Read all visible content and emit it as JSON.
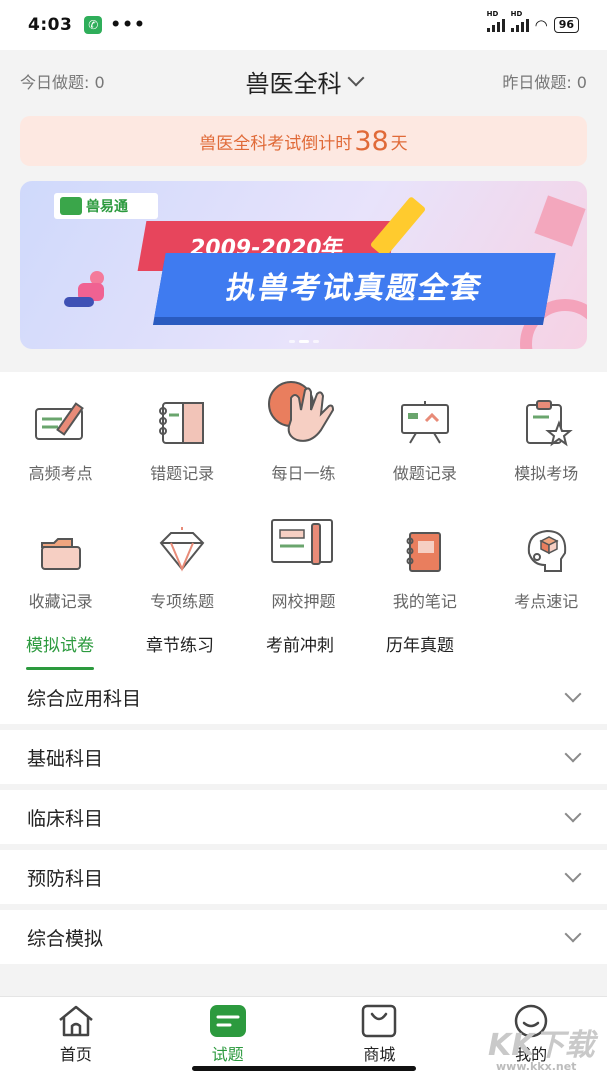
{
  "status_bar": {
    "time": "4:03",
    "more": "•••",
    "signal_tag": "HD",
    "battery": "96"
  },
  "header": {
    "today_count": "今日做题: 0",
    "title": "兽医全科",
    "yesterday_count": "昨日做题: 0"
  },
  "countdown": {
    "prefix": "兽医全科考试倒计时",
    "days": "38",
    "suffix": "天"
  },
  "banner": {
    "logo_text": "兽易通",
    "year_range": "2009-2020年",
    "headline": "执兽考试真题全套"
  },
  "grid": [
    {
      "label": "高频考点",
      "icon": "board-pencil-icon"
    },
    {
      "label": "错题记录",
      "icon": "notebook-icon"
    },
    {
      "label": "每日一练",
      "icon": "hand-ok-icon"
    },
    {
      "label": "做题记录",
      "icon": "easel-icon"
    },
    {
      "label": "模拟考场",
      "icon": "clipboard-star-icon"
    },
    {
      "label": "收藏记录",
      "icon": "folder-icon"
    },
    {
      "label": "专项练题",
      "icon": "diamond-icon"
    },
    {
      "label": "网校押题",
      "icon": "document-pen-icon"
    },
    {
      "label": "我的笔记",
      "icon": "notepad-icon"
    },
    {
      "label": "考点速记",
      "icon": "head-box-icon"
    }
  ],
  "tabs": [
    "模拟试卷",
    "章节练习",
    "考前冲刺",
    "历年真题"
  ],
  "list": [
    "综合应用科目",
    "基础科目",
    "临床科目",
    "预防科目",
    "综合模拟"
  ],
  "nav": [
    "首页",
    "试题",
    "商城",
    "我的"
  ],
  "watermark": {
    "text": "KK下载",
    "url": "www.kkx.net"
  },
  "colors": {
    "accent": "#2c9a3e",
    "countdown": "#e06a38"
  }
}
